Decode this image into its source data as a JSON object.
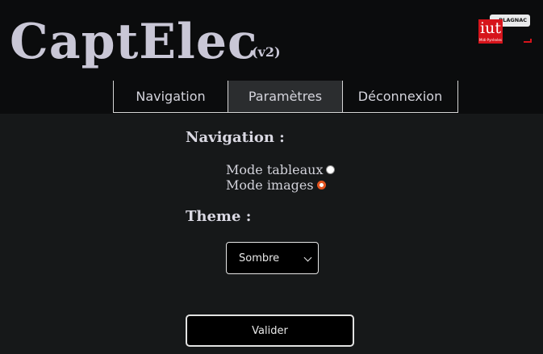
{
  "header": {
    "brand": "CaptElec",
    "version": "(v2)",
    "logo": {
      "tag": "BLAGNAC",
      "main": "iut",
      "sub": "Midi-Pyrénées",
      "color": "#d6141b"
    }
  },
  "nav": {
    "items": [
      {
        "label": "Navigation"
      },
      {
        "label": "Paramètres"
      },
      {
        "label": "Déconnexion"
      }
    ],
    "active_index": 1
  },
  "settings": {
    "navigation_title": "Navigation :",
    "navigation_options": [
      {
        "label": "Mode tableaux",
        "checked": false
      },
      {
        "label": "Mode images",
        "checked": true
      }
    ],
    "theme_title": "Theme :",
    "theme_select": {
      "value": "Sombre"
    },
    "submit_label": "Valider"
  },
  "colors": {
    "background": "#161819",
    "header_background": "#0b0c0d",
    "text": "#d9d8e2",
    "radio_accent": "#e2531f"
  }
}
